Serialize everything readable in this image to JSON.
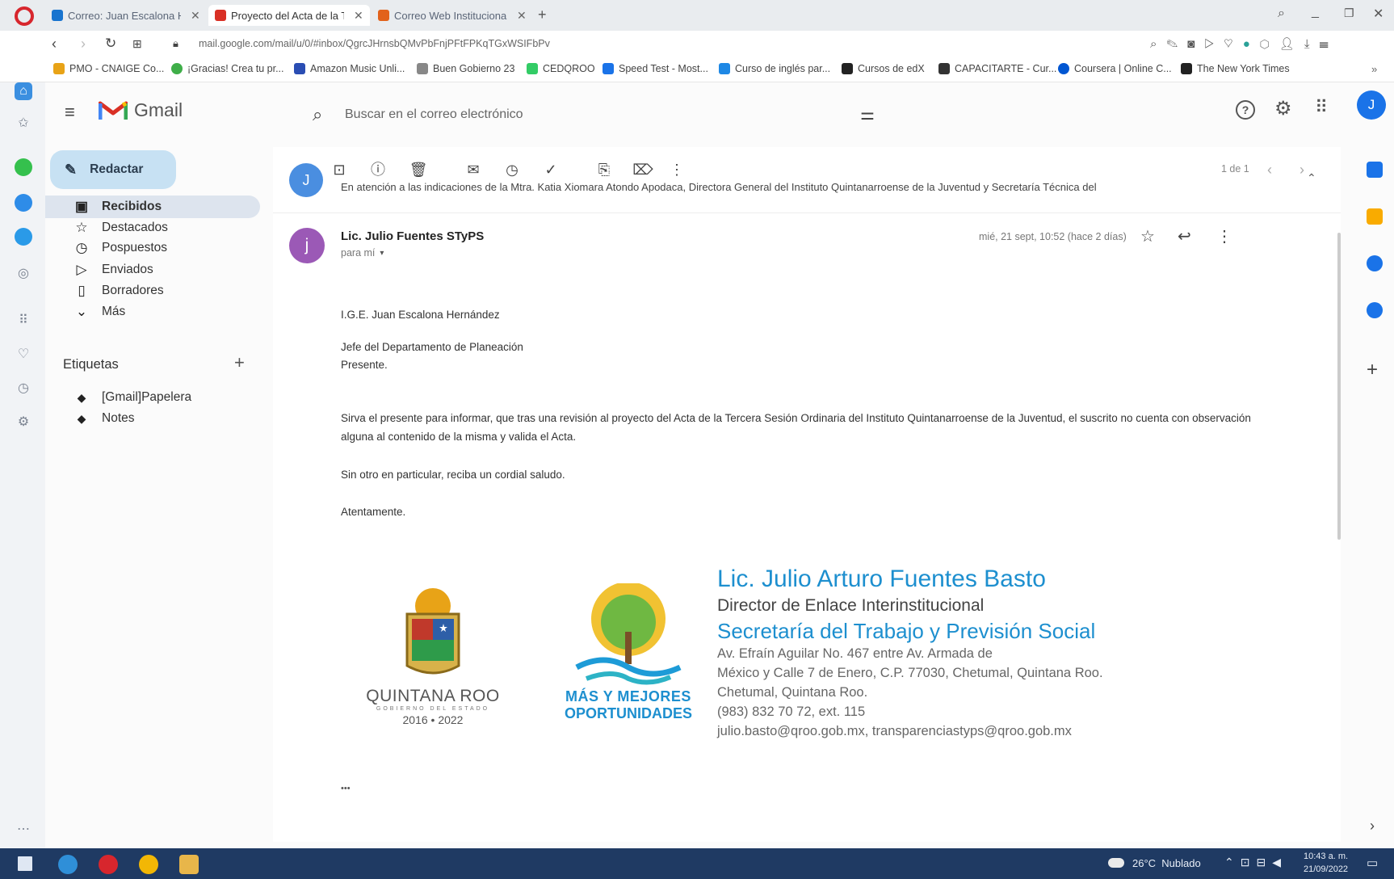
{
  "browser": {
    "tabs": [
      {
        "label": "Correo: Juan Escalona Her",
        "active": false
      },
      {
        "label": "Proyecto del Acta de la Te",
        "active": true
      },
      {
        "label": "Correo Web Institucional -",
        "active": false
      }
    ],
    "url": "mail.google.com/mail/u/0/#inbox/QgrcJHrnsbQMvPbFnjPFtFPKqTGxWSIFbPv",
    "bookmarks": [
      "PMO - CNAIGE Co...",
      "¡Gracias! Crea tu pr...",
      "Amazon Music Unli...",
      "Buen Gobierno 23",
      "CEDQROO",
      "Speed Test - Most...",
      "Curso de inglés par...",
      "Cursos de edX",
      "CAPACITARTE - Cur...",
      "Coursera | Online C...",
      "The New York Times"
    ]
  },
  "gmail": {
    "logo": "Gmail",
    "search_placeholder": "Buscar en el correo electrónico",
    "avatar_letter": "J",
    "compose_label": "Redactar",
    "nav": [
      {
        "label": "Recibidos",
        "icon": "inbox-icon",
        "active": true
      },
      {
        "label": "Destacados",
        "icon": "star-icon",
        "active": false
      },
      {
        "label": "Pospuestos",
        "icon": "clock-icon",
        "active": false
      },
      {
        "label": "Enviados",
        "icon": "send-icon",
        "active": false
      },
      {
        "label": "Borradores",
        "icon": "draft-icon",
        "active": false
      },
      {
        "label": "Más",
        "icon": "chevron-down-icon",
        "active": false
      }
    ],
    "labels_title": "Etiquetas",
    "labels": [
      "[Gmail]Papelera",
      "Notes"
    ],
    "pager": "1 de 1"
  },
  "thread": {
    "collapsed_snippet": "En atención a las indicaciones de la Mtra. Katia Xiomara Atondo Apodaca, Directora General del Instituto Quintanarroense de la Juventud y Secretaría Técnica del",
    "sender_initial": "j",
    "sender": "Lic. Julio Fuentes STyPS",
    "to": "para mí",
    "date": "mié, 21 sept, 10:52 (hace 2 días)",
    "body": [
      "I.G.E. Juan Escalona Hernández",
      "Jefe del Departamento de Planeación",
      "Presente.",
      "Sirva el presente para informar, que tras una revisión al proyecto del Acta de la Tercera Sesión Ordinaria del Instituto Quintanarroense de la Juventud, el suscrito no cuenta con observación alguna al contenido de la misma y valida el Acta.",
      "Sin otro en particular, reciba un cordial saludo.",
      "Atentamente."
    ],
    "signature": {
      "name": "Lic. Julio Arturo Fuentes Basto",
      "position": "Director de Enlace Interinstitucional",
      "secretariat": "Secretaría del Trabajo y Previsión Social",
      "address1": "Av. Efraín Aguilar No. 467 entre Av. Armada de",
      "address2": "México y Calle 7 de Enero, C.P. 77030, Chetumal, Quintana Roo.",
      "address3": "Chetumal, Quintana Roo.",
      "phone": "(983) 832 70 72, ext. 115",
      "emails": "julio.basto@qroo.gob.mx, transparenciastyps@qroo.gob.mx",
      "logo_qroo_name": "QUINTANA ROO",
      "logo_qroo_sub": "GOBIERNO DEL ESTADO",
      "logo_qroo_years": "2016 • 2022",
      "logo_opp_line1": "MÁS Y MEJORES",
      "logo_opp_line2": "OPORTUNIDADES"
    },
    "ellipsis": "•••"
  },
  "taskbar": {
    "weather": "26°C  Nublado",
    "time": "10:43 a. m.",
    "date": "21/09/2022"
  },
  "colors": {
    "gmail_red": "#d93025",
    "accent_blue": "#1a73e8",
    "sig_blue": "#1d8fcf",
    "nav_active": "#dde4ee"
  }
}
